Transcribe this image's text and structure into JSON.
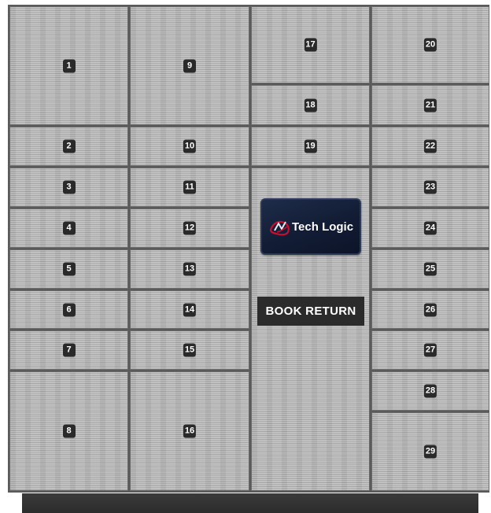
{
  "logo": {
    "text": "Tech Logic"
  },
  "book_return": {
    "label": "BOOK RETURN"
  },
  "lockers": {
    "1": "1",
    "2": "2",
    "3": "3",
    "4": "4",
    "5": "5",
    "6": "6",
    "7": "7",
    "8": "8",
    "9": "9",
    "10": "10",
    "11": "11",
    "12": "12",
    "13": "13",
    "14": "14",
    "15": "15",
    "16": "16",
    "17": "17",
    "18": "18",
    "19": "19",
    "20": "20",
    "21": "21",
    "22": "22",
    "23": "23",
    "24": "24",
    "25": "25",
    "26": "26",
    "27": "27",
    "28": "28",
    "29": "29"
  },
  "colors": {
    "door": "#b9b9b9",
    "frame": "#5a5a5a",
    "number_badge": "#2a2a2a",
    "logo_panel": "#121c34",
    "logo_mark_red": "#c8102e"
  }
}
